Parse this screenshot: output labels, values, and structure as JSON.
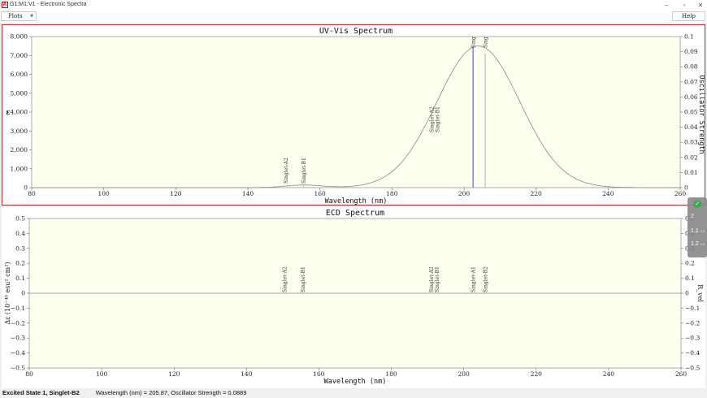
{
  "window": {
    "title": "G1:M1:V1 - Electronic Spectra",
    "icon": "app-icon",
    "controls": [
      "minimize",
      "restore",
      "close"
    ]
  },
  "menu": {
    "plots_label": "Plots",
    "help_label": "Help"
  },
  "uv": {
    "title": "UV-Vis Spectrum",
    "ylabel": "ε",
    "y2label": "Oscillator Strength",
    "xlabel": "Wavelength (nm)",
    "xticks": [
      "80",
      "100",
      "120",
      "140",
      "160",
      "180",
      "200",
      "220",
      "240",
      "260"
    ],
    "yticks": [
      "0",
      "1,000",
      "2,000",
      "3,000",
      "4,000",
      "5,000",
      "6,000",
      "7,000",
      "8,000"
    ],
    "y2ticks": [
      "0",
      "0.01",
      "0.02",
      "0.03",
      "0.04",
      "0.05",
      "0.06",
      "0.07",
      "0.08",
      "0.09",
      "0.1"
    ],
    "state_labels": [
      "Singlet-A2",
      "Singlet-B1",
      "Singlet-A2",
      "Singlet-B1",
      "Sing",
      "Sing"
    ]
  },
  "ecd": {
    "title": "ECD Spectrum",
    "ylabel": "Δε (10⁻⁴⁰ esu² cm²)",
    "y2label": "R_vel",
    "xlabel": "Wavelength (nm)",
    "xticks": [
      "80",
      "100",
      "120",
      "140",
      "160",
      "180",
      "200",
      "220",
      "240",
      "260"
    ],
    "yticks": [
      "−0.5",
      "−0.4",
      "−0.3",
      "−0.2",
      "−0.1",
      "0",
      "0.1",
      "0.2",
      "0.3",
      "0.4",
      "0.5"
    ],
    "y2ticks": [
      "−0.5",
      "−0.4",
      "−0.3",
      "−0.2",
      "−0.1",
      "0",
      "0.1",
      "0.2",
      "0.3",
      "0.4",
      "0.5"
    ],
    "state_labels": [
      "Singlet-A2",
      "Singlet-B1",
      "Singlet-A2",
      "Singlet-B1",
      "Singlet-A1",
      "Singlet-B2"
    ]
  },
  "side_widget": {
    "items": [
      "2",
      "1.1",
      "1.2"
    ],
    "subs": [
      "",
      "0.5",
      "0.5"
    ]
  },
  "status": {
    "left": "Excited State 1, Singlet-B2",
    "right": "Wavelength (nm) = 205.87, Oscillator Strength = 0.0889"
  },
  "chart_data": [
    {
      "type": "line",
      "title": "UV-Vis Spectrum",
      "xlabel": "Wavelength (nm)",
      "ylabel": "ε",
      "y2label": "Oscillator Strength",
      "xlim": [
        80,
        260
      ],
      "ylim": [
        0,
        8000
      ],
      "y2lim": [
        0,
        0.1
      ],
      "broadened_bands": [
        {
          "center": 155.5,
          "height": 140,
          "width": 5.0
        },
        {
          "center": 204.0,
          "height": 7500,
          "width": 11.5
        }
      ],
      "sticks": [
        {
          "label": "Singlet-A2",
          "x": 150.5,
          "f": 0.0
        },
        {
          "label": "Singlet-B1",
          "x": 155.5,
          "f": 0.002
        },
        {
          "label": "Singlet-A2",
          "x": 191.0,
          "f": 0.0
        },
        {
          "label": "Singlet-B1",
          "x": 192.5,
          "f": 0.0
        },
        {
          "label": "Sing",
          "x": 202.5,
          "f": 0.093
        },
        {
          "label": "Sing",
          "x": 205.87,
          "f": 0.0889
        }
      ]
    },
    {
      "type": "line",
      "title": "ECD Spectrum",
      "xlabel": "Wavelength (nm)",
      "ylabel": "Δε (10⁻⁴⁰ esu² cm²)",
      "y2label": "R_vel",
      "xlim": [
        80,
        260
      ],
      "ylim": [
        -0.5,
        0.5
      ],
      "values_constant": 0,
      "sticks": [
        {
          "label": "Singlet-A2",
          "x": 150.5
        },
        {
          "label": "Singlet-B1",
          "x": 155.5
        },
        {
          "label": "Singlet-A2",
          "x": 191.0
        },
        {
          "label": "Singlet-B1",
          "x": 192.5
        },
        {
          "label": "Singlet-A1",
          "x": 202.5
        },
        {
          "label": "Singlet-B2",
          "x": 205.87
        }
      ]
    }
  ],
  "colors": {
    "plot_bg": "#fffff0",
    "curve": "#888888",
    "stick_a": "#4444cc",
    "stick_b": "#aaaadd",
    "uv_border": "#aa3333"
  }
}
